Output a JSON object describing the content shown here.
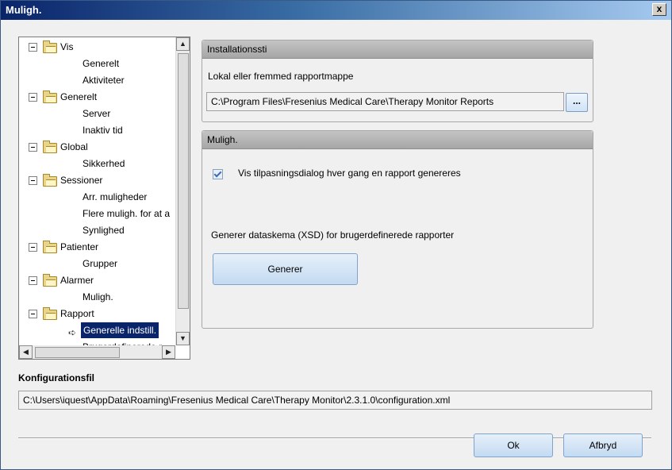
{
  "window": {
    "title": "Muligh.",
    "close_label": "x"
  },
  "tree": {
    "nodes": [
      {
        "label": "Vis",
        "children": [
          "Generelt",
          "Aktiviteter"
        ]
      },
      {
        "label": "Generelt",
        "children": [
          "Server",
          "Inaktiv tid"
        ]
      },
      {
        "label": "Global",
        "children": [
          "Sikkerhed"
        ]
      },
      {
        "label": "Sessioner",
        "children": [
          "Arr. muligheder",
          "Flere muligh. for at a",
          "Synlighed"
        ]
      },
      {
        "label": "Patienter",
        "children": [
          "Grupper"
        ]
      },
      {
        "label": "Alarmer",
        "children": [
          "Muligh."
        ]
      },
      {
        "label": "Rapport",
        "children": [
          "Generelle indstill.",
          "Brugerdefinerede r"
        ]
      }
    ],
    "selected": "Generelle indstill."
  },
  "installation": {
    "header": "Installationssti",
    "label": "Lokal eller fremmed rapportmappe",
    "path": "C:\\Program Files\\Fresenius Medical Care\\Therapy Monitor Reports",
    "browse_label": "..."
  },
  "options": {
    "header": "Muligh.",
    "checkbox_label": "Vis tilpasningsdialog hver gang en rapport genereres",
    "checkbox_checked": true,
    "schema_label": "Generer dataskema (XSD) for brugerdefinerede rapporter",
    "generate_button": "Generer"
  },
  "config": {
    "label": "Konfigurationsfil",
    "path": "C:\\Users\\iquest\\AppData\\Roaming\\Fresenius Medical Care\\Therapy Monitor\\2.3.1.0\\configuration.xml"
  },
  "buttons": {
    "ok": "Ok",
    "cancel": "Afbryd"
  },
  "scrollbar": {
    "up": "▲",
    "down": "▼",
    "left": "◀",
    "right": "▶"
  },
  "icons": {
    "selected_arrow": "➪"
  }
}
